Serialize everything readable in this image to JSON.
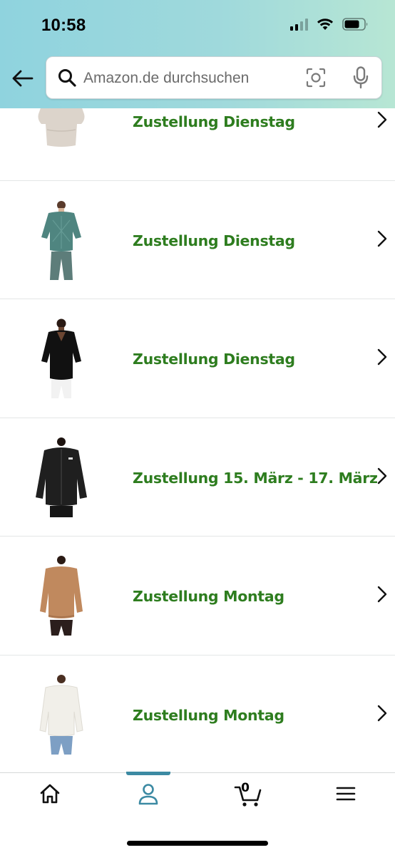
{
  "status_bar": {
    "time": "10:58"
  },
  "header": {
    "search": {
      "placeholder": "Amazon.de durchsuchen"
    },
    "icons": [
      "back-arrow-icon",
      "search-icon",
      "camera-scan-icon",
      "microphone-icon"
    ]
  },
  "products": [
    {
      "delivery": "Zustellung Dienstag",
      "image": "beige-knit-sweater"
    },
    {
      "delivery": "Zustellung Dienstag",
      "image": "teal-lace-blouse"
    },
    {
      "delivery": "Zustellung Dienstag",
      "image": "black-v-neck-blouse"
    },
    {
      "delivery": "Zustellung 15. März - 17. März",
      "image": "black-fleece-jacket"
    },
    {
      "delivery": "Zustellung Montag",
      "image": "camel-sweatshirt"
    },
    {
      "delivery": "Zustellung Montag",
      "image": "white-sweatshirt"
    }
  ],
  "tabbar": {
    "tabs": [
      "home-icon",
      "account-icon",
      "cart-icon",
      "menu-icon"
    ],
    "active_tab": "account-icon",
    "cart_count": "0"
  },
  "colors": {
    "header_gradient": [
      "#8fd3de",
      "#b7e6d4"
    ],
    "delivery_green": "#2e7d1f",
    "active_tab": "#3c8aa3"
  }
}
